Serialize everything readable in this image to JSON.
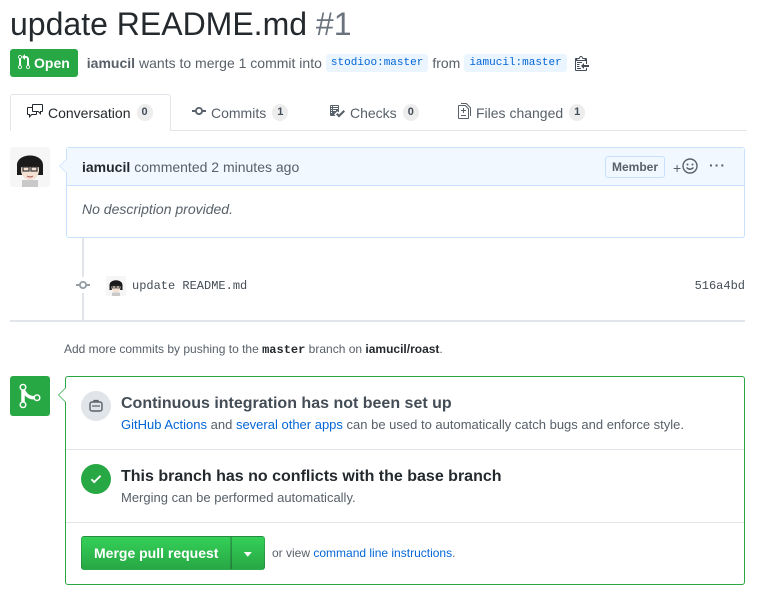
{
  "pr": {
    "title": "update README.md",
    "number": "#1",
    "state": "Open",
    "author": "iamucil",
    "merge_text": "wants to merge 1 commit into",
    "base_ref": "stodioo:master",
    "from_text": "from",
    "head_ref": "iamucil:master"
  },
  "tabs": [
    {
      "label": "Conversation",
      "count": "0",
      "icon": "comment-discussion-icon"
    },
    {
      "label": "Commits",
      "count": "1",
      "icon": "git-commit-icon"
    },
    {
      "label": "Checks",
      "count": "0",
      "icon": "checklist-icon"
    },
    {
      "label": "Files changed",
      "count": "1",
      "icon": "file-diff-icon"
    }
  ],
  "comment": {
    "author": "iamucil",
    "action": "commented 2 minutes ago",
    "badge": "Member",
    "reaction_plus": "+",
    "more": "···",
    "body": "No description provided."
  },
  "commit": {
    "message": "update README.md",
    "sha": "516a4bd"
  },
  "hint": {
    "before": "Add more commits by pushing to the",
    "branch": "master",
    "middle": "branch on",
    "repo": "iamucil/roast",
    "end": "."
  },
  "merge": {
    "ci_title": "Continuous integration has not been set up",
    "ci_link1": "GitHub Actions",
    "ci_and": "and",
    "ci_link2": "several other apps",
    "ci_rest": "can be used to automatically catch bugs and enforce style.",
    "conflict_title": "This branch has no conflicts with the base branch",
    "conflict_sub": "Merging can be performed automatically.",
    "button": "Merge pull request",
    "or_view": "or view",
    "cli_link": "command line instructions",
    "cli_end": "."
  },
  "colors": {
    "green": "#28a745",
    "link": "#0366d6",
    "comment_border": "#c8e1ff"
  }
}
